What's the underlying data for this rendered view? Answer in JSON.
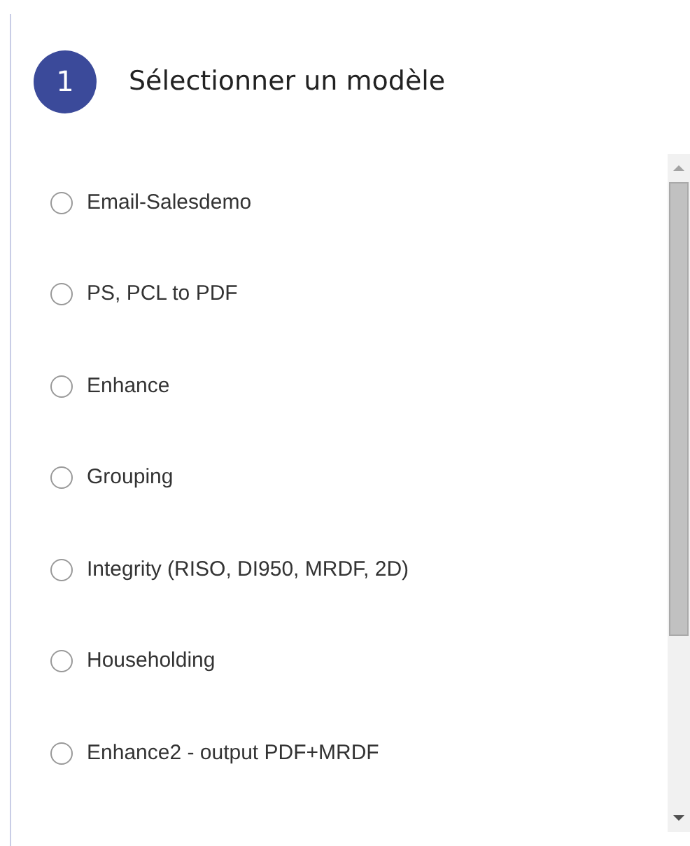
{
  "step": {
    "number": "1",
    "title": "Sélectionner un modèle"
  },
  "templates": [
    {
      "label": "Email-Salesdemo",
      "selected": false
    },
    {
      "label": "PS, PCL to PDF",
      "selected": false
    },
    {
      "label": "Enhance",
      "selected": false
    },
    {
      "label": "Grouping",
      "selected": false
    },
    {
      "label": "Integrity (RISO, DI950, MRDF, 2D)",
      "selected": false
    },
    {
      "label": "Householding",
      "selected": false
    },
    {
      "label": "Enhance2 - output PDF+MRDF",
      "selected": false
    }
  ]
}
